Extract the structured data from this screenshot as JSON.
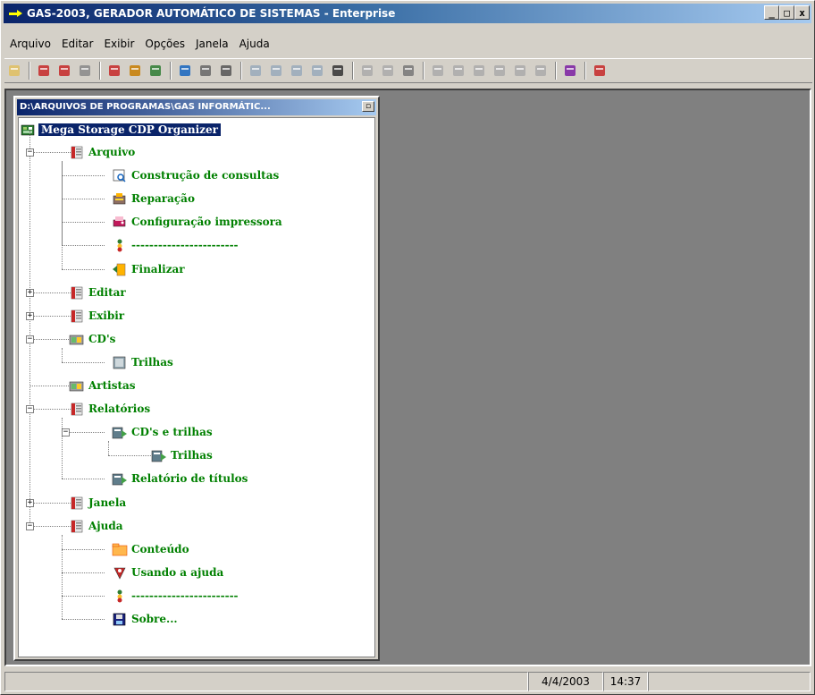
{
  "window": {
    "title": "GAS-2003, GERADOR AUTOMÁTICO DE SISTEMAS - Enterprise",
    "controls": {
      "min": "_",
      "max": "□",
      "close": "x"
    }
  },
  "menu": [
    "Arquivo",
    "Editar",
    "Exibir",
    "Opções",
    "Janela",
    "Ajuda"
  ],
  "toolbar_icons": [
    "open-folder-icon",
    "pdf-icon",
    "document-icon",
    "document-list-icon",
    "book-icon",
    "pencil-icon",
    "rocket-icon",
    "database-icon",
    "report-icon",
    "printer-icon",
    "insert-icon",
    "cut-icon",
    "copy-icon",
    "paste-icon",
    "bin-icon",
    "find-icon",
    "replace-icon",
    "grid-icon",
    "undo-icon",
    "redo-icon",
    "indent-icon",
    "outdent-icon",
    "align-icon",
    "list-icon",
    "help-book-icon",
    "home-icon"
  ],
  "child_window": {
    "title": "D:\\ARQUIVOS DE PROGRAMAS\\GAS INFORMÁTIC...",
    "restore": "▫"
  },
  "tree": {
    "root": "Mega Storage CDP Organizer",
    "nodes": [
      {
        "label": "Arquivo",
        "icon": "folder-red-icon",
        "level": 1,
        "expander": "−"
      },
      {
        "label": "Construção de consultas",
        "icon": "query-icon",
        "level": 2
      },
      {
        "label": "Reparação",
        "icon": "repair-icon",
        "level": 2
      },
      {
        "label": "Configuração impressora",
        "icon": "printer-config-icon",
        "level": 2
      },
      {
        "label": "------------------------",
        "icon": "separator-icon",
        "level": 2
      },
      {
        "label": "Finalizar",
        "icon": "exit-icon",
        "level": 2
      },
      {
        "label": "Editar",
        "icon": "folder-red-icon",
        "level": 1,
        "expander": "+"
      },
      {
        "label": "Exibir",
        "icon": "folder-red-icon",
        "level": 1,
        "expander": "+"
      },
      {
        "label": "CD's",
        "icon": "cd-icon",
        "level": 1,
        "expander": "−"
      },
      {
        "label": "Trilhas",
        "icon": "tracks-icon",
        "level": 2
      },
      {
        "label": "Artistas",
        "icon": "cd-icon",
        "level": 1
      },
      {
        "label": "Relatórios",
        "icon": "folder-red-icon",
        "level": 1,
        "expander": "−"
      },
      {
        "label": "CD's e trilhas",
        "icon": "report-icon",
        "level": 2,
        "expander": "−"
      },
      {
        "label": "Trilhas",
        "icon": "report-icon",
        "level": 3
      },
      {
        "label": "Relatório de títulos",
        "icon": "report-icon",
        "level": 2
      },
      {
        "label": "Janela",
        "icon": "folder-red-icon",
        "level": 1,
        "expander": "+"
      },
      {
        "label": "Ajuda",
        "icon": "folder-red-icon",
        "level": 1,
        "expander": "−"
      },
      {
        "label": "Conteúdo",
        "icon": "folder-icon",
        "level": 2
      },
      {
        "label": "Usando a ajuda",
        "icon": "help-icon",
        "level": 2
      },
      {
        "label": "------------------------",
        "icon": "separator-icon",
        "level": 2
      },
      {
        "label": "Sobre...",
        "icon": "about-icon",
        "level": 2
      }
    ]
  },
  "status": {
    "date": "4/4/2003",
    "time": "14:37"
  }
}
